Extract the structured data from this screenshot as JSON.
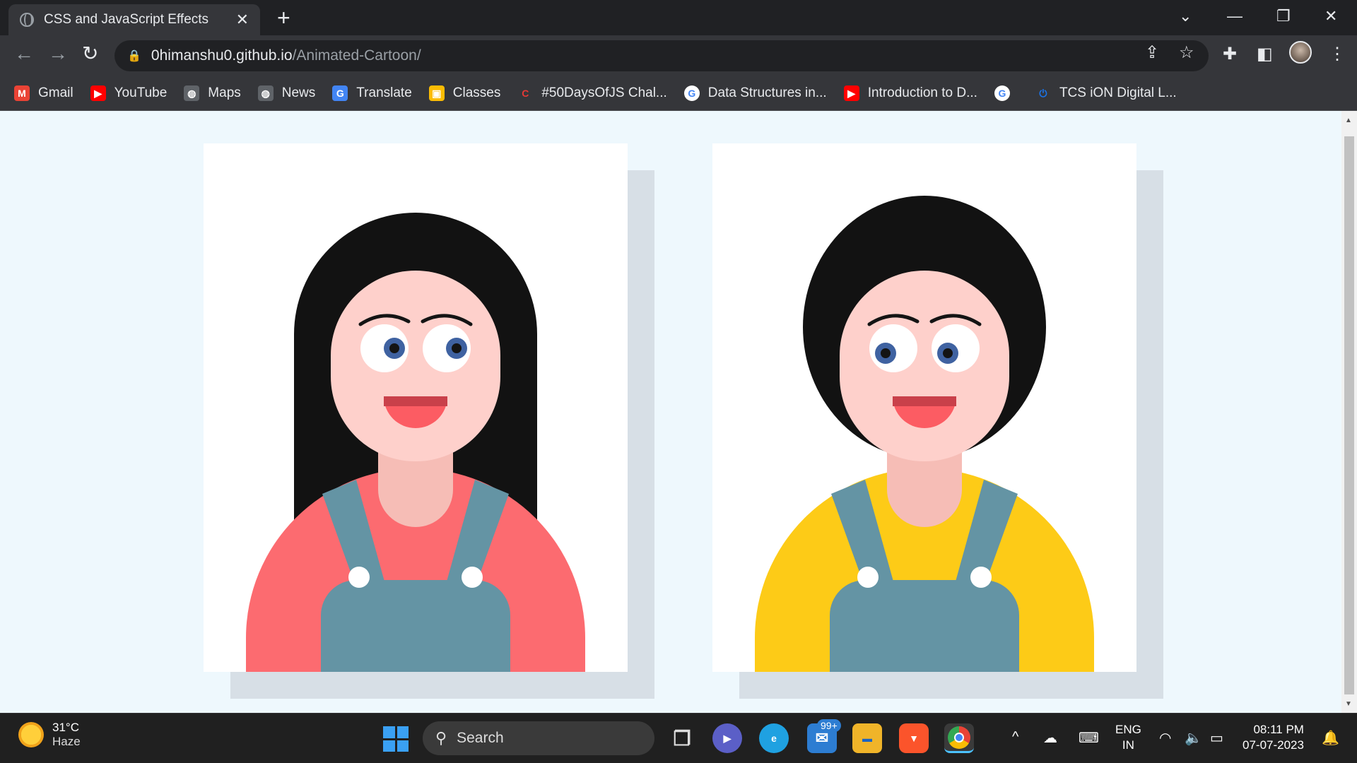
{
  "tab": {
    "title": "CSS and JavaScript Effects",
    "close": "✕"
  },
  "toolbar": {
    "url_host": "0himanshu0.github.io",
    "url_path": "/Animated-Cartoon/"
  },
  "bookmarks": [
    {
      "label": "Gmail",
      "icon": "gmail-icon",
      "color": "#ea4335",
      "glyph": "M"
    },
    {
      "label": "YouTube",
      "icon": "youtube-icon",
      "color": "#ff0000",
      "glyph": "▶"
    },
    {
      "label": "Maps",
      "icon": "globe-icon",
      "color": "#5f6368",
      "glyph": "◍"
    },
    {
      "label": "News",
      "icon": "globe-icon",
      "color": "#5f6368",
      "glyph": "◍"
    },
    {
      "label": "Translate",
      "icon": "translate-icon",
      "color": "#4285f4",
      "glyph": "G"
    },
    {
      "label": "Classes",
      "icon": "classroom-icon",
      "color": "#fbbc04",
      "glyph": "▣"
    },
    {
      "label": "#50DaysOfJS Chal...",
      "icon": "c-icon",
      "color": "#35363a",
      "glyph": "C"
    },
    {
      "label": "Data Structures in...",
      "icon": "google-icon",
      "color": "#35363a",
      "glyph": "G"
    },
    {
      "label": "Introduction to D...",
      "icon": "youtube-icon",
      "color": "#ff0000",
      "glyph": "▶"
    },
    {
      "label": "",
      "icon": "google-icon",
      "color": "#ffffff",
      "glyph": "G"
    },
    {
      "label": "TCS iON Digital L...",
      "icon": "power-icon",
      "color": "#35363a",
      "glyph": "⏻"
    }
  ],
  "cartoons": [
    {
      "name": "girl",
      "hair": "long",
      "shirt_color": "#fc6b70",
      "hair_color": "#121212",
      "skin_color": "#fed0cb",
      "overalls_color": "#6494a4"
    },
    {
      "name": "boy",
      "hair": "round",
      "shirt_color": "#fdcb17",
      "hair_color": "#121212",
      "skin_color": "#fed0cb",
      "overalls_color": "#6494a4"
    }
  ],
  "taskbar": {
    "temperature": "31°C",
    "weather": "Haze",
    "search_placeholder": "Search",
    "mail_badge": "99+",
    "lang_line1": "ENG",
    "lang_line2": "IN",
    "time": "08:11 PM",
    "date": "07-07-2023"
  }
}
